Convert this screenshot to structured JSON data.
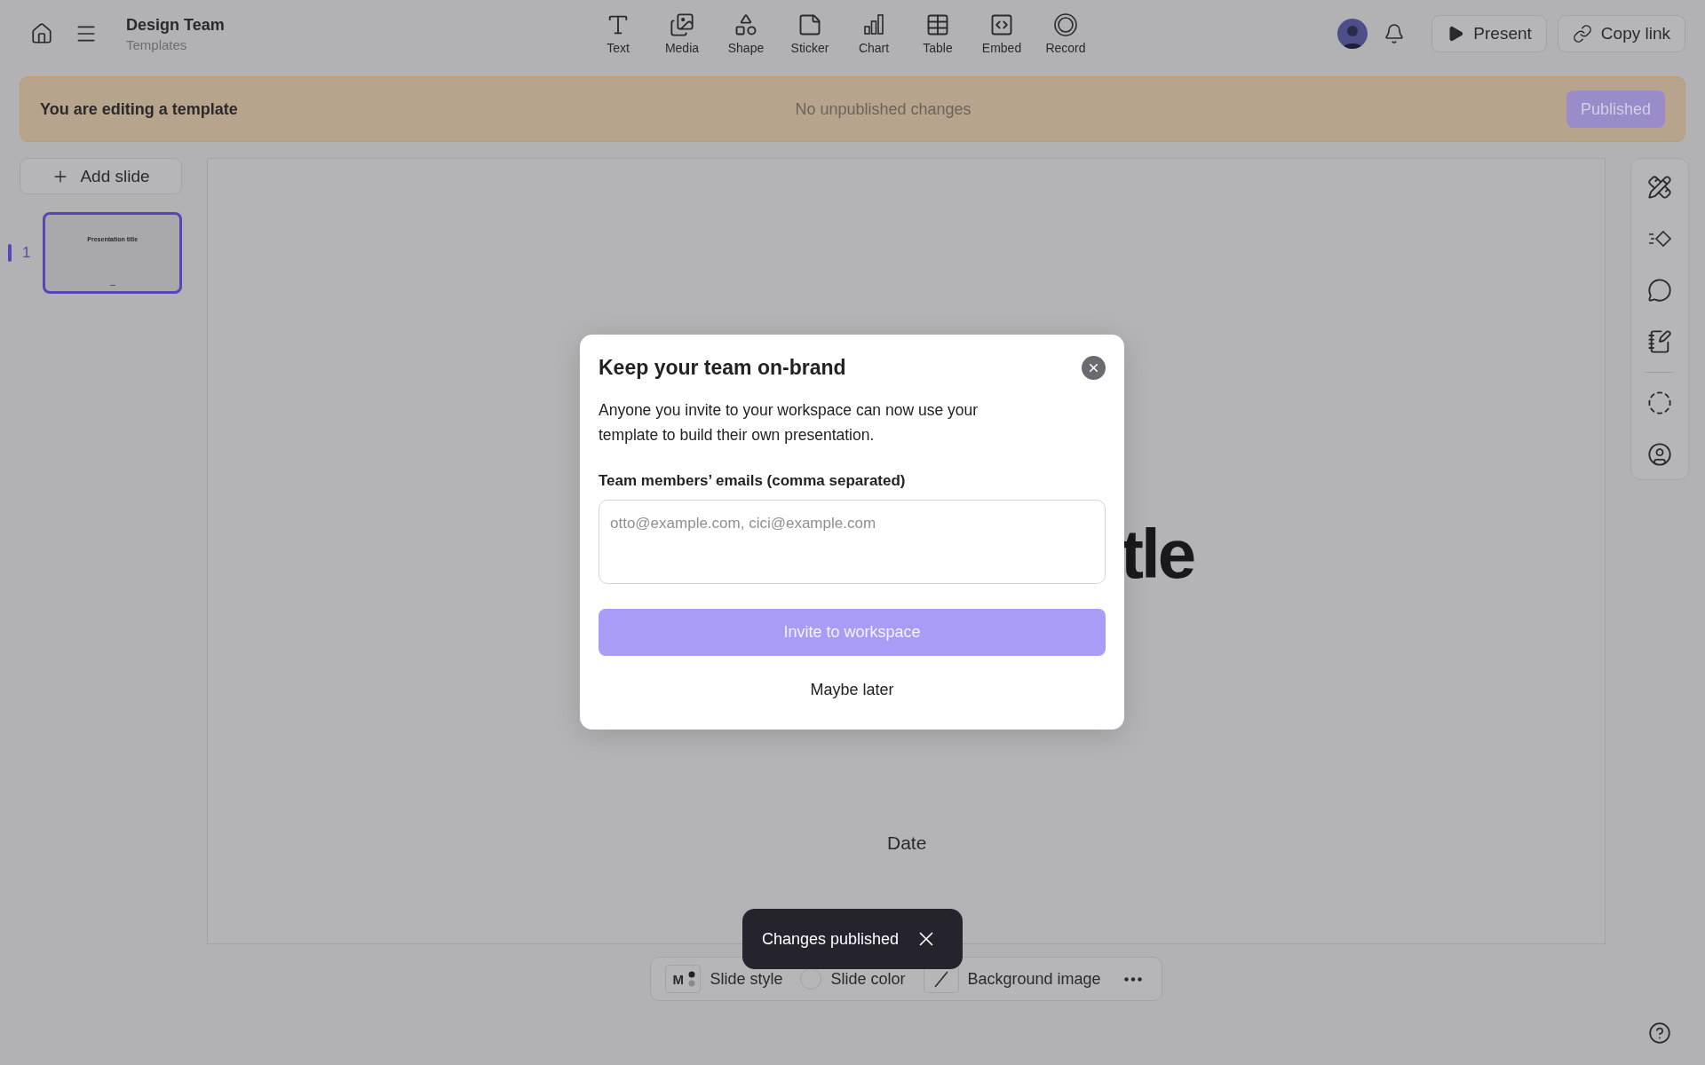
{
  "header": {
    "title": "Design Team",
    "subtitle": "Templates"
  },
  "toolbar": [
    {
      "label": "Text"
    },
    {
      "label": "Media"
    },
    {
      "label": "Shape"
    },
    {
      "label": "Sticker"
    },
    {
      "label": "Chart"
    },
    {
      "label": "Table"
    },
    {
      "label": "Embed"
    },
    {
      "label": "Record"
    }
  ],
  "actions": [
    {
      "label": "Present",
      "kind": "present"
    },
    {
      "label": "Copy link",
      "kind": "link"
    }
  ],
  "banner": {
    "message": "You are editing a template",
    "status": "No unpublished changes",
    "button": "Published"
  },
  "add_slide": "Add slide",
  "slides": [
    {
      "number": "1",
      "selected": true,
      "title": "Presentation title"
    }
  ],
  "slide": {
    "title": "tle",
    "date": "Date"
  },
  "bottom_bar": [
    {
      "kind": "style",
      "label": "Slide style",
      "badge": "M"
    },
    {
      "kind": "color",
      "label": "Slide color"
    },
    {
      "kind": "image",
      "label": "Background image"
    }
  ],
  "toast": {
    "message": "Changes published"
  },
  "dialog": {
    "title": "Keep your team on-brand",
    "body": "Anyone you invite to your workspace can now use your template to build their own presentation.",
    "field_label": "Team members’ emails (comma separated)",
    "placeholder": "otto@example.com, cici@example.com",
    "primary": "Invite to workspace",
    "secondary": "Maybe later"
  }
}
